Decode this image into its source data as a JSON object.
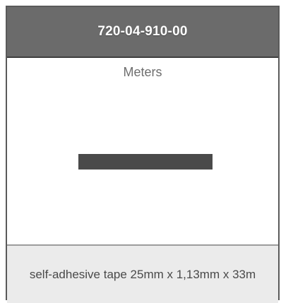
{
  "header": {
    "title": "720-04-910-00"
  },
  "main": {
    "unit_label": "Meters"
  },
  "footer": {
    "description": "self-adhesive tape 25mm x 1,13mm x 33m"
  },
  "colors": {
    "header_bg": "#6b6b6b",
    "tape_bar": "#4a4a4a",
    "footer_bg": "#ebebeb"
  }
}
